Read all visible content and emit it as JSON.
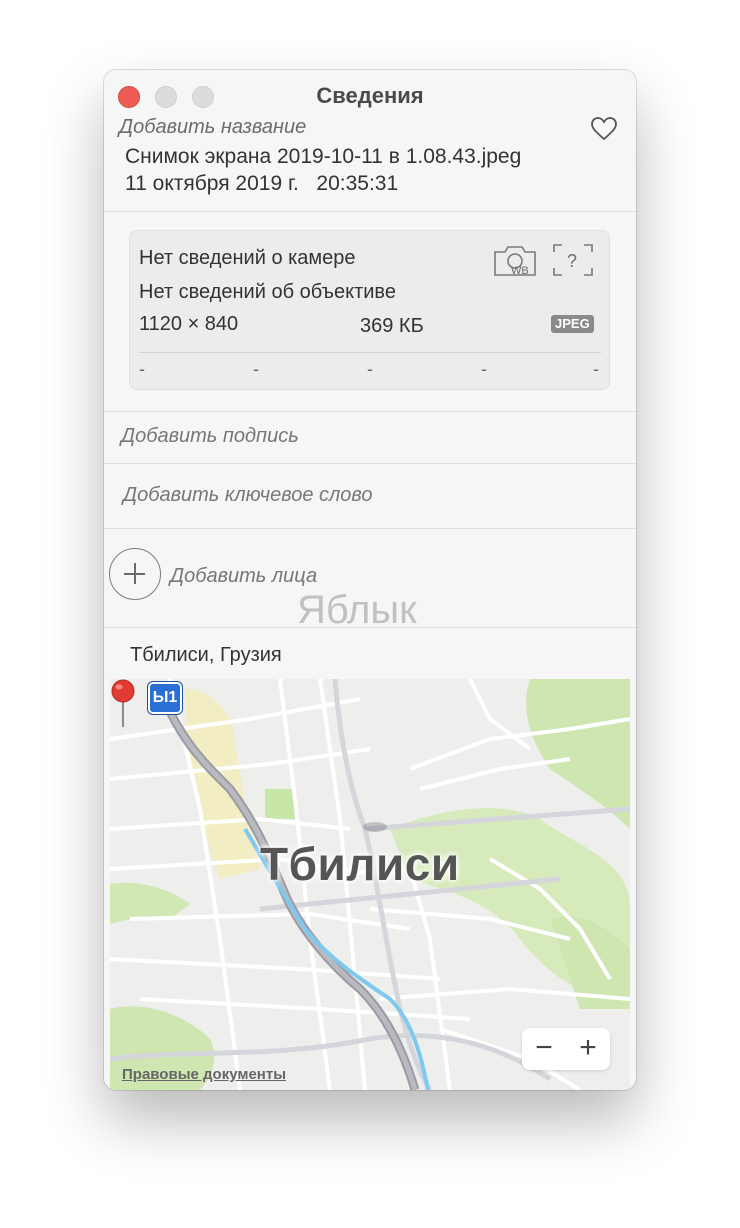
{
  "window": {
    "title": "Сведения"
  },
  "photo": {
    "add_title_placeholder": "Добавить название",
    "filename": "Снимок экрана 2019-10-11 в 1.08.43.jpeg",
    "datetime": "11 октября 2019 г.   20:35:31"
  },
  "camera": {
    "camera_info": "Нет сведений о камере",
    "lens_info": "Нет сведений об объективе",
    "dimensions": "1120 × 840",
    "file_size": "369 КБ",
    "format_badge": "JPEG",
    "exif_values": [
      "-",
      "-",
      "-",
      "-",
      "-"
    ],
    "icons": [
      "camera-wb-icon",
      "unknown-metering-icon"
    ]
  },
  "fields": {
    "caption_placeholder": "Добавить подпись",
    "keyword_placeholder": "Добавить ключевое слово",
    "faces_label": "Добавить лица"
  },
  "watermark": "Яблык",
  "location": {
    "name": "Тбилиси, Грузия",
    "map_city_label": "Тбилиси",
    "route_shield": "Ы1",
    "legal_link": "Правовые документы",
    "zoom_out": "−",
    "zoom_in": "+"
  },
  "colors": {
    "close": "#ee5b55",
    "pin": "#e23b33",
    "park": "#cfe6b1",
    "river": "#7fc9ef",
    "route_badge": "#2a6fd6"
  }
}
